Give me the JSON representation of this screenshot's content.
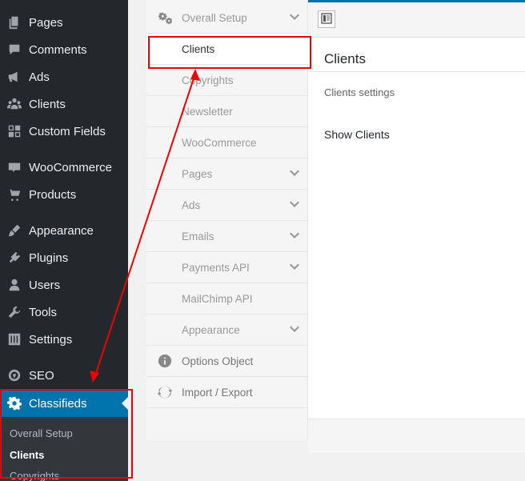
{
  "sidebar": {
    "items": [
      {
        "label": "Pages",
        "icon": "pages-icon"
      },
      {
        "label": "Comments",
        "icon": "comments-icon"
      },
      {
        "label": "Ads",
        "icon": "megaphone-icon"
      },
      {
        "label": "Clients",
        "icon": "groups-icon"
      },
      {
        "label": "Custom Fields",
        "icon": "grid-icon"
      },
      {
        "label": "WooCommerce",
        "icon": "woocommerce-icon"
      },
      {
        "label": "Products",
        "icon": "cart-icon"
      },
      {
        "label": "Appearance",
        "icon": "brush-icon"
      },
      {
        "label": "Plugins",
        "icon": "plugin-icon"
      },
      {
        "label": "Users",
        "icon": "user-icon"
      },
      {
        "label": "Tools",
        "icon": "wrench-icon"
      },
      {
        "label": "Settings",
        "icon": "sliders-icon"
      },
      {
        "label": "SEO",
        "icon": "seo-icon"
      },
      {
        "label": "Classifieds",
        "icon": "gear-icon"
      }
    ],
    "submenu": [
      "Overall Setup",
      "Clients",
      "Copyrights"
    ]
  },
  "tabs": [
    {
      "label": "Overall Setup",
      "has_children": true,
      "icon": "gears-icon"
    },
    {
      "label": "Clients",
      "has_children": false
    },
    {
      "label": "Copyrights",
      "has_children": false
    },
    {
      "label": "Newsletter",
      "has_children": false
    },
    {
      "label": "WooCommerce",
      "has_children": false
    },
    {
      "label": "Pages",
      "has_children": true
    },
    {
      "label": "Ads",
      "has_children": true
    },
    {
      "label": "Emails",
      "has_children": true
    },
    {
      "label": "Payments API",
      "has_children": true
    },
    {
      "label": "MailChimp API",
      "has_children": false
    },
    {
      "label": "Appearance",
      "has_children": true
    },
    {
      "label": "Options Object",
      "has_children": false,
      "icon": "info-icon"
    },
    {
      "label": "Import / Export",
      "has_children": false,
      "icon": "refresh-icon"
    }
  ],
  "content": {
    "title": "Clients",
    "description": "Clients settings",
    "field_label": "Show Clients"
  },
  "colors": {
    "sidebar_bg": "#23282d",
    "accent": "#0073aa",
    "annotation": "#e00000"
  }
}
